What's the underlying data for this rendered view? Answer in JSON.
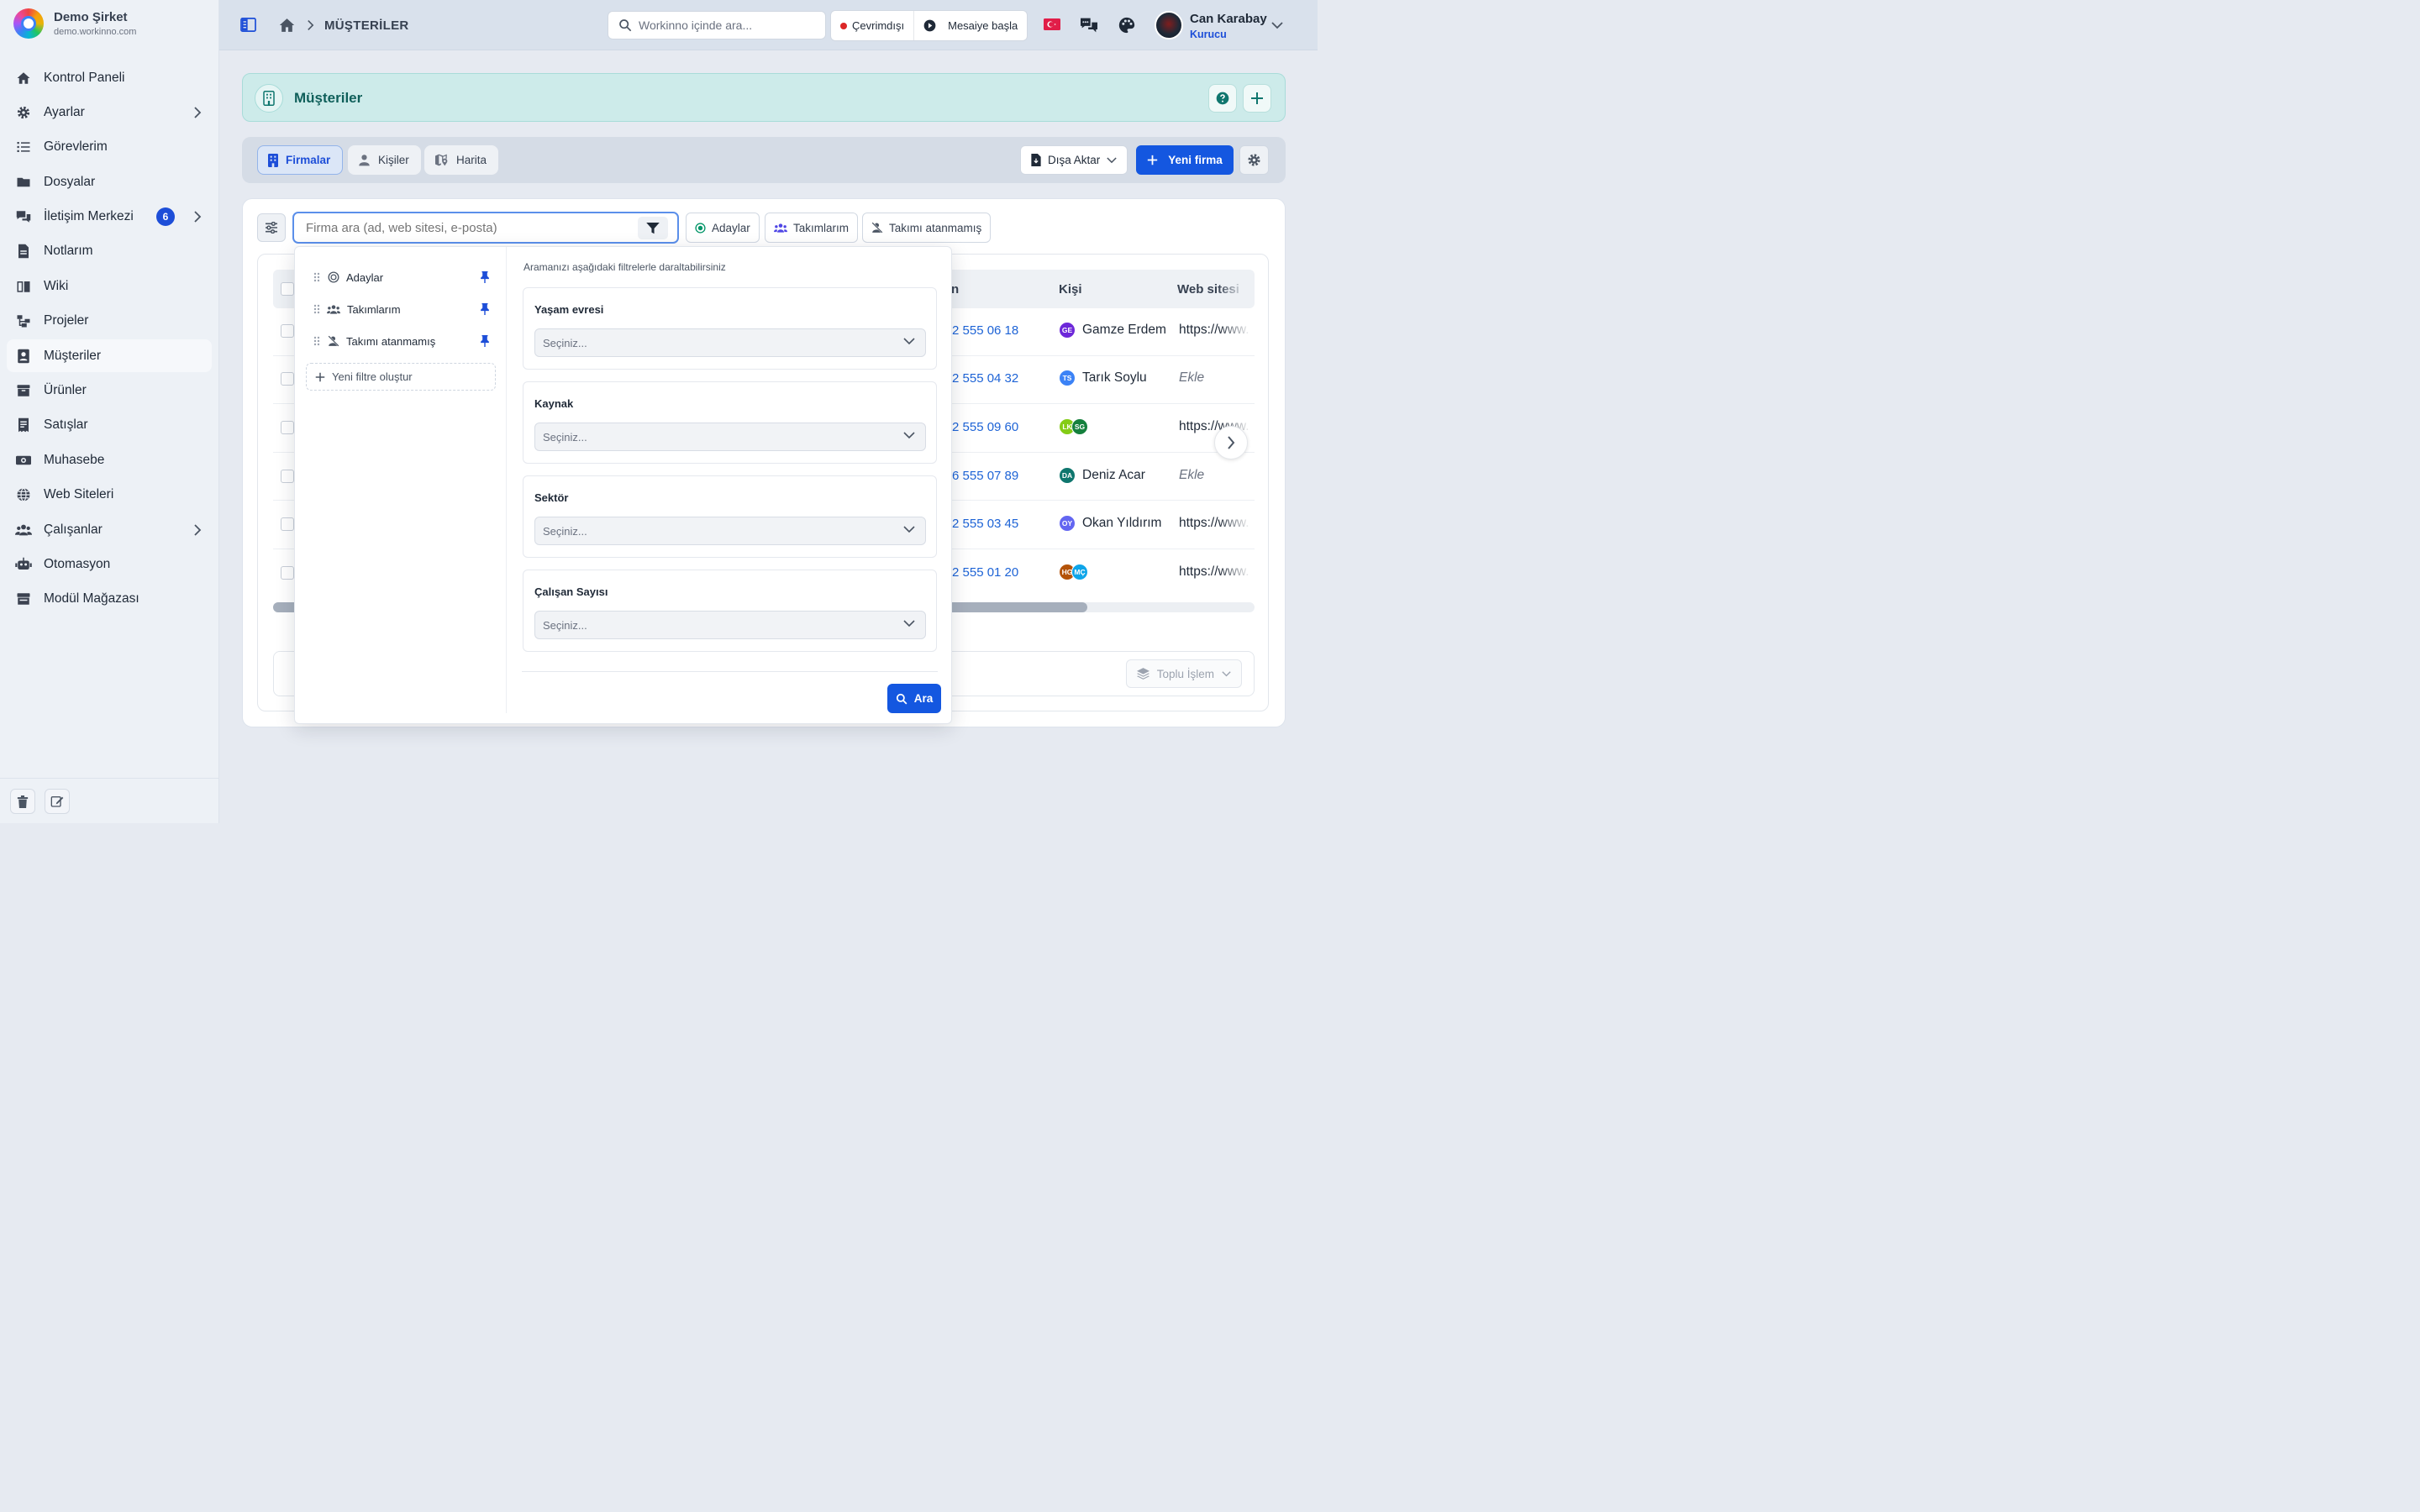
{
  "brand": {
    "name": "Demo Şirket",
    "url": "demo.workinno.com"
  },
  "sidebar": {
    "items": [
      {
        "label": "Kontrol Paneli",
        "icon": "home-icon"
      },
      {
        "label": "Ayarlar",
        "icon": "gear-icon"
      },
      {
        "label": "Görevlerim",
        "icon": "task-list-icon"
      },
      {
        "label": "Dosyalar",
        "icon": "folder-icon"
      },
      {
        "label": "İletişim Merkezi",
        "icon": "chat-icon",
        "badge": "6"
      },
      {
        "label": "Notlarım",
        "icon": "note-icon"
      },
      {
        "label": "Wiki",
        "icon": "book-icon"
      },
      {
        "label": "Projeler",
        "icon": "project-icon"
      },
      {
        "label": "Müşteriler",
        "icon": "contact-card-icon",
        "active": true
      },
      {
        "label": "Ürünler",
        "icon": "box-icon"
      },
      {
        "label": "Satışlar",
        "icon": "receipt-icon"
      },
      {
        "label": "Muhasebe",
        "icon": "money-icon"
      },
      {
        "label": "Web Siteleri",
        "icon": "globe-icon"
      },
      {
        "label": "Çalışanlar",
        "icon": "users-icon"
      },
      {
        "label": "Otomasyon",
        "icon": "robot-icon"
      },
      {
        "label": "Modül Mağazası",
        "icon": "store-icon"
      }
    ]
  },
  "topbar": {
    "breadcrumb": "MÜŞTERİLER",
    "search_placeholder": "Workinno içinde ara...",
    "status_label": "Çevrimdışı",
    "shift_label": "Mesaiye başla",
    "user_name": "Can Karabay",
    "user_role": "Kurucu"
  },
  "page_header": {
    "title": "Müşteriler"
  },
  "tabs": [
    {
      "label": "Firmalar",
      "active": true
    },
    {
      "label": "Kişiler"
    },
    {
      "label": "Harita"
    }
  ],
  "actions": {
    "export_label": "Dışa Aktar",
    "new_label": "Yeni firma"
  },
  "search": {
    "placeholder": "Firma ara (ad, web sitesi, e-posta)",
    "chips": [
      "Adaylar",
      "Takımlarım",
      "Takımı atanmamış"
    ]
  },
  "table": {
    "headers": {
      "phone_fragment": "n",
      "person": "Kişi",
      "website": "Web sitesi"
    },
    "rows": [
      {
        "phone": "2 555 06 18",
        "person": "Gamze Erdem",
        "avatars": [
          {
            "initials": "GE",
            "color": "#6d28d9"
          }
        ],
        "website": "https://www.",
        "website_empty": false
      },
      {
        "phone": "2 555 04 32",
        "person": "Tarık Soylu",
        "avatars": [
          {
            "initials": "TS",
            "color": "#3b82f6"
          }
        ],
        "website": "Ekle",
        "website_empty": true
      },
      {
        "phone": "2 555 09 60",
        "person": "",
        "avatars": [
          {
            "initials": "LK",
            "color": "#84cc16"
          },
          {
            "initials": "SG",
            "color": "#15803d"
          }
        ],
        "website": "https://www.",
        "website_empty": false
      },
      {
        "phone": "6 555 07 89",
        "person": "Deniz Acar",
        "avatars": [
          {
            "initials": "DA",
            "color": "#0f766e"
          }
        ],
        "website": "Ekle",
        "website_empty": true
      },
      {
        "phone": "2 555 03 45",
        "person": "Okan Yıldırım",
        "avatars": [
          {
            "initials": "OY",
            "color": "#6366f1"
          }
        ],
        "website": "https://www.",
        "website_empty": false
      },
      {
        "phone": "2 555 01 20",
        "person": "",
        "avatars": [
          {
            "initials": "HG",
            "color": "#b45309"
          },
          {
            "initials": "MÇ",
            "color": "#0ea5e9"
          }
        ],
        "website": "https://www.",
        "website_empty": false
      }
    ],
    "bulk_label": "Toplu İşlem",
    "horizontal_scroll_fraction": 0.83
  },
  "filter_popup": {
    "saved_filters": [
      {
        "label": "Adaylar",
        "icon": "target-icon"
      },
      {
        "label": "Takımlarım",
        "icon": "team-icon"
      },
      {
        "label": "Takımı atanmamış",
        "icon": "user-slash-icon"
      }
    ],
    "new_filter_label": "Yeni filtre oluştur",
    "hint": "Aramanızı aşağıdaki filtrelerle daraltabilirsiniz",
    "groups": [
      {
        "label": "Yaşam evresi",
        "placeholder": "Seçiniz..."
      },
      {
        "label": "Kaynak",
        "placeholder": "Seçiniz..."
      },
      {
        "label": "Sektör",
        "placeholder": "Seçiniz..."
      },
      {
        "label": "Çalışan Sayısı",
        "placeholder": "Seçiniz..."
      }
    ],
    "search_button": "Ara"
  },
  "colors": {
    "primary": "#1457e0",
    "accent_teal": "#0f5f5a",
    "status_offline": "#dc2626"
  }
}
